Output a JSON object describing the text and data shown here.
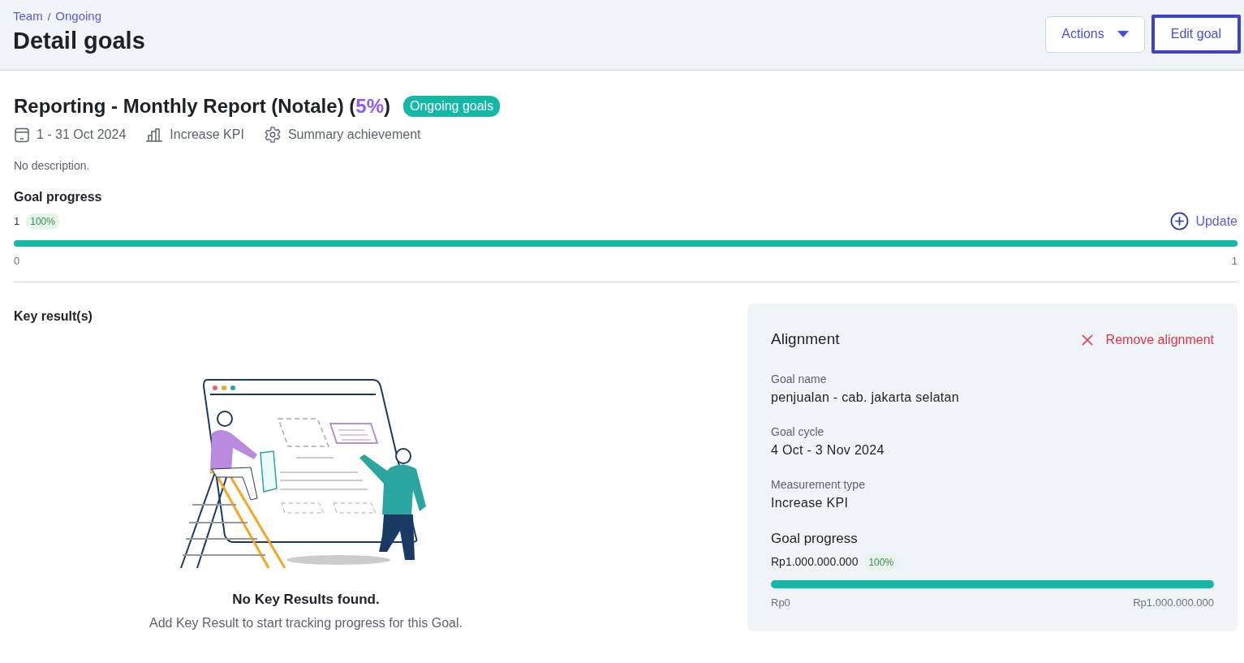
{
  "breadcrumb": {
    "items": [
      {
        "label": "Team"
      },
      {
        "label": "Ongoing"
      }
    ],
    "separator": "/"
  },
  "page_title": "Detail goals",
  "header_buttons": {
    "actions": "Actions",
    "edit": "Edit goal"
  },
  "goal": {
    "title": "Reporting - Monthly Report (Notale) (",
    "percent": "5%",
    "title_end": ")",
    "status": "Ongoing goals",
    "meta": [
      {
        "kind": "calendar",
        "text": "1 - 31 Oct 2024"
      },
      {
        "kind": "chart",
        "text": "Increase KPI"
      },
      {
        "kind": "gear",
        "text": "Summary achievement"
      }
    ],
    "description": "No description."
  },
  "goal_progress": {
    "heading": "Goal progress",
    "current": "1",
    "percent": "100%",
    "update": "Update",
    "level": 1,
    "min": "0",
    "max": "1"
  },
  "key_results": {
    "heading": "Key result(s)",
    "empty_title": "No Key Results found.",
    "empty_text": "Add Key Result to start tracking progress for this Goal."
  },
  "alignment": {
    "heading": "Alignment",
    "remove": "Remove alignment",
    "fields": [
      {
        "label": "Goal name",
        "value": "penjualan - cab. jakarta selatan"
      },
      {
        "label": "Goal cycle",
        "value": "4 Oct - 3 Nov 2024"
      },
      {
        "label": "Measurement type",
        "value": "Increase KPI"
      }
    ],
    "progress": {
      "heading": "Goal progress",
      "current": "Rp1.000.000.000",
      "percent": "100%",
      "level": 1,
      "min": "Rp0",
      "max": "Rp1.000.000.000"
    }
  }
}
